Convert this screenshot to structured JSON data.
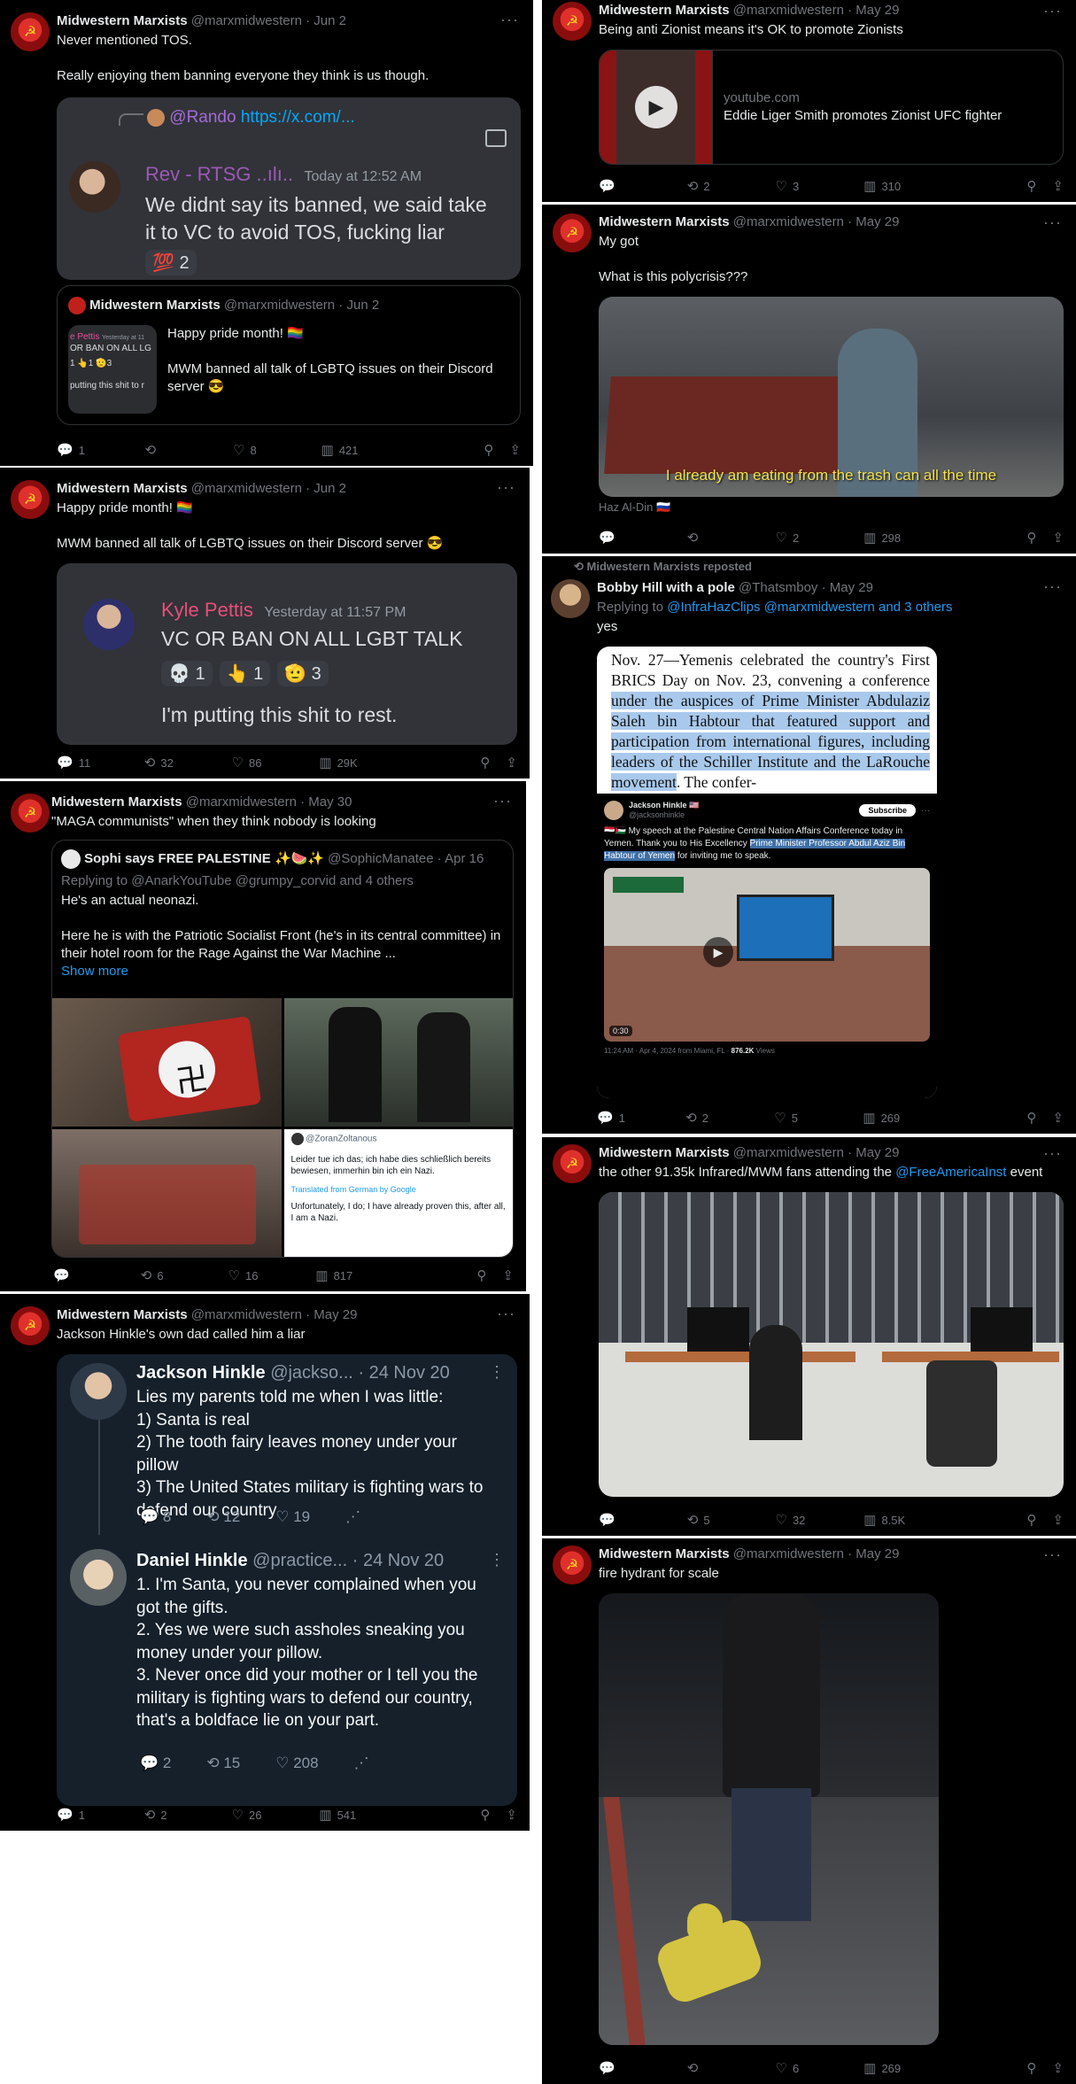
{
  "tweets": {
    "t1": {
      "name": "Midwestern Marxists",
      "handle_date": "@marxmidwestern · Jun 2",
      "more": "···",
      "line1": "Never mentioned TOS.",
      "line2": "Really enjoying them banning everyone they think is us though.",
      "discord": {
        "reply_user": "@Rando",
        "reply_link": "https://x.com/...",
        "user": "Rev - RTSG ..ılı..",
        "time": "Today at 12:52 AM",
        "message": "We didnt say its banned, we said take it to VC to avoid TOS, fucking liar",
        "reaction_emoji": "💯",
        "reaction_count": "2"
      },
      "quote": {
        "name": "Midwestern Marxists",
        "handle_date": "@marxmidwestern · Jun 2",
        "line1": "Happy pride month! 🏳️‍🌈",
        "line2": "MWM banned all talk of LGBTQ issues on their Discord server 😎",
        "thumb_name": "e Pettis",
        "thumb_time": "Yesterday at 11",
        "thumb_text": "OR BAN ON ALL LG",
        "thumb_reacts": "1  👆1  🫡3",
        "thumb_bottom": "putting this shit to r"
      },
      "actions": {
        "replies": "1",
        "retweets": "",
        "likes": "8",
        "views": "421"
      }
    },
    "t2": {
      "name": "Midwestern Marxists",
      "handle_date": "@marxmidwestern · Jun 2",
      "more": "···",
      "line1": "Happy pride month! 🏳️‍🌈",
      "line2": "MWM banned all talk of LGBTQ issues on their Discord server 😎",
      "discord": {
        "user": "Kyle Pettis",
        "time": "Yesterday at 11:57 PM",
        "message": "VC OR BAN ON ALL LGBT TALK",
        "r1": "💀",
        "r1c": "1",
        "r2": "👆",
        "r2c": "1",
        "r3": "🫡",
        "r3c": "3",
        "message2": "I'm putting this shit to rest."
      },
      "actions": {
        "replies": "11",
        "retweets": "32",
        "likes": "86",
        "views": "29K"
      }
    },
    "t3": {
      "name": "Midwestern Marxists",
      "handle_date": "@marxmidwestern · May 30",
      "more": "···",
      "line1": "\"MAGA communists\" when they think nobody is looking",
      "quote": {
        "name": "Sophi says FREE PALESTINE ✨🍉✨",
        "handle_date": "@SophicManatee · Apr 16",
        "replying": "Replying to @AnarkYouTube @grumpy_corvid and 4 others",
        "line1": "He's an actual neonazi.",
        "line2": "Here he is with the Patriotic Socialist Front (he's in its central committee) in their hotel room for the Rage Against the War Machine ...",
        "show_more": "Show more",
        "screenshot_handle": "@ZoranZoltanous",
        "screenshot_de": "Leider tue ich das; ich habe dies schließlich bereits bewiesen, immerhin bin ich ein Nazi.",
        "screenshot_translated": "Translated from German by Google",
        "screenshot_en": "Unfortunately, I do; I have already proven this, after all, I am a Nazi."
      },
      "actions": {
        "replies": "",
        "retweets": "6",
        "likes": "16",
        "views": "817"
      }
    },
    "t4": {
      "name": "Midwestern Marxists",
      "handle_date": "@marxmidwestern · May 29",
      "more": "···",
      "line1": "Jackson Hinkle's own dad called him a liar",
      "shot": {
        "p1_name": "Jackson Hinkle",
        "p1_handle": "@jackso... · 24 Nov 20",
        "p1_text": [
          "Lies my parents told me when I was little:",
          "1) Santa is real",
          "2) The tooth fairy leaves money under your pillow",
          "3) The United States military is fighting wars to defend our country"
        ],
        "p1_replies": "8",
        "p1_rts": "12",
        "p1_likes": "19",
        "p2_name": "Daniel Hinkle",
        "p2_handle": "@practice... · 24 Nov 20",
        "p2_text": [
          "1. I'm Santa, you never complained when you got the gifts.",
          "2. Yes we were such assholes sneaking you money under your pillow.",
          "3. Never once did your mother or I tell you the military is fighting wars to defend our country, that's a boldface lie on your part."
        ],
        "p2_replies": "2",
        "p2_rts": "15",
        "p2_likes": "208"
      },
      "actions": {
        "replies": "1",
        "retweets": "2",
        "likes": "26",
        "views": "541"
      }
    },
    "t5": {
      "name": "Midwestern Marxists",
      "handle_date": "@marxmidwestern · May 29",
      "more": "···",
      "line1": "Being anti Zionist means it's OK to promote Zionists",
      "card": {
        "domain": "youtube.com",
        "title": "Eddie Liger Smith promotes Zionist UFC fighter"
      },
      "actions": {
        "replies": "",
        "retweets": "2",
        "likes": "3",
        "views": "310"
      }
    },
    "t6": {
      "name": "Midwestern Marxists",
      "handle_date": "@marxmidwestern · May 29",
      "more": "···",
      "line1": "My got",
      "line2": "What is this polycrisis???",
      "caption": "I already am eating from the trash can all the time",
      "credit": "Haz Al-Din 🇷🇺",
      "actions": {
        "replies": "",
        "retweets": "",
        "likes": "2",
        "views": "298"
      }
    },
    "t7": {
      "repost_label": "Midwestern Marxists reposted",
      "name": "Bobby Hill with a pole",
      "handle_date": "@Thatsmboy · May 29",
      "more": "···",
      "replying_prefix": "Replying to",
      "replying_users": "@InfraHazClips @marxmidwestern and 3 others",
      "line1": "yes",
      "doc": {
        "pre": "Nov. 27—Yemenis celebrated the country's First BRICS Day on Nov. 23, convening a conference",
        "highlighted": "under the auspices of Prime Minister Abdulaziz Saleh bin Habtour that featured support and participation from international figures, including leaders of the Schiller Institute and the LaRouche movement",
        "post": ". The confer-"
      },
      "inner": {
        "name": "Jackson Hinkle 🇺🇸",
        "handle": "@jacksonhinkle",
        "subscribe": "Subscribe",
        "text_pre": "🇾🇪🇵🇸 My speech at the Palestine Central Nation Affairs Conference today in Yemen. Thank you to His Excellency",
        "text_hl": "Prime Minister Professor Abdul Aziz Bin Habtour of Yemen",
        "text_post": "for inviting me to speak.",
        "duration": "0:30",
        "meta": "11:24 AM · Apr 4, 2024 from Miami, FL ·",
        "views": "876.2K",
        "views_label": "Views"
      },
      "actions": {
        "replies": "1",
        "retweets": "2",
        "likes": "5",
        "views": "269"
      }
    },
    "t8": {
      "name": "Midwestern Marxists",
      "handle_date": "@marxmidwestern · May 29",
      "more": "···",
      "line_pre": "the other 91.35k Infrared/MWM fans attending the",
      "line_link": "@FreeAmericaInst",
      "line_post": "event",
      "actions": {
        "replies": "",
        "retweets": "5",
        "likes": "32",
        "views": "8.5K"
      }
    },
    "t9": {
      "name": "Midwestern Marxists",
      "handle_date": "@marxmidwestern · May 29",
      "more": "···",
      "line1": "fire hydrant for scale",
      "actions": {
        "replies": "",
        "retweets": "",
        "likes": "6",
        "views": "269"
      }
    }
  },
  "icons": {
    "reply": "💬",
    "retweet": "⟲",
    "like": "♡",
    "views": "📊",
    "bookmark": "🔖",
    "share": "⇪"
  }
}
